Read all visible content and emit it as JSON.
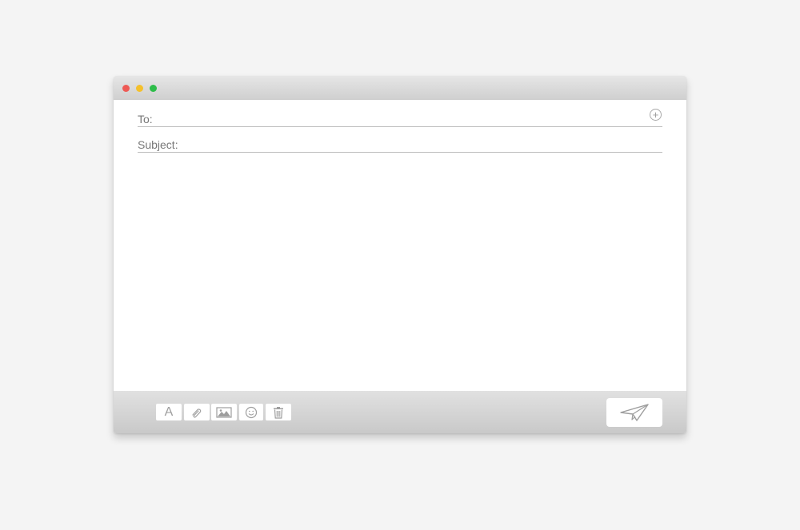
{
  "window": {
    "traffic_lights": {
      "close_color": "#ee5a55",
      "minimize_color": "#f4c02c",
      "zoom_color": "#2ebd4a"
    }
  },
  "compose": {
    "to_label": "To:",
    "subject_label": "Subject:",
    "add_contact_icon": "plus-circle-icon"
  },
  "toolbar": {
    "font_label": "A",
    "icons": [
      "font-icon",
      "paperclip-icon",
      "image-icon",
      "smiley-icon",
      "trash-icon"
    ],
    "send_icon": "paper-plane-icon"
  },
  "colors": {
    "background": "#f4f4f4",
    "icon_gray": "#9e9e9e"
  }
}
